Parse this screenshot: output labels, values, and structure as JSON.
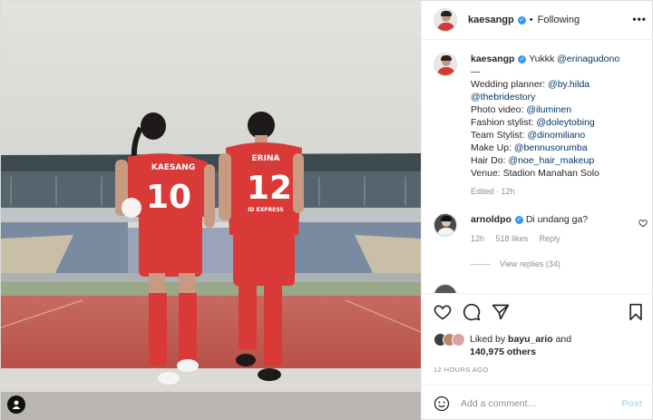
{
  "post": {
    "author": {
      "username": "kaesangp",
      "verified": true,
      "follow_status": "Following"
    },
    "photo": {
      "jersey_left": {
        "name": "KAESANG",
        "number": "10"
      },
      "jersey_right": {
        "name": "ERINA",
        "number": "12"
      },
      "sponsor_text": "ID EXPRESS"
    },
    "caption": {
      "username": "kaesangp",
      "text": "Yukkk",
      "mention": "@erinagudono",
      "separator": "—",
      "lines": [
        {
          "label": "Wedding planner:",
          "mention": "@by.hilda"
        },
        {
          "label": "",
          "mention": "@thebridestory"
        },
        {
          "label": "Photo video:",
          "mention": "@iluminen"
        },
        {
          "label": "Fashion stylist:",
          "mention": "@doleytobing"
        },
        {
          "label": "Team Stylist:",
          "mention": "@dinomiliano"
        },
        {
          "label": "Make Up:",
          "mention": "@bennusorumba"
        },
        {
          "label": "Hair Do:",
          "mention": "@noe_hair_makeup"
        },
        {
          "label": "Venue: Stadion Manahan Solo",
          "mention": ""
        }
      ],
      "meta": "Edited · 12h"
    },
    "comment": {
      "username": "arnoldpo",
      "verified": true,
      "text": "Di undang ga?",
      "time": "12h",
      "likes": "518 likes",
      "reply": "Reply",
      "view_replies": "View replies (34)"
    },
    "likes": {
      "prefix": "Liked by",
      "user": "bayu_ario",
      "and": "and",
      "count": "140,975 others"
    },
    "time_ago": "12 HOURS AGO",
    "add_comment": {
      "placeholder": "Add a comment…",
      "post_label": "Post"
    },
    "more_icon": "•••",
    "dot": "•"
  },
  "colors": {
    "link": "#00376b",
    "verified": "#3897f0",
    "muted": "#8e8e8e",
    "post_disabled": "#b2dffc",
    "jersey": "#d93a38"
  }
}
